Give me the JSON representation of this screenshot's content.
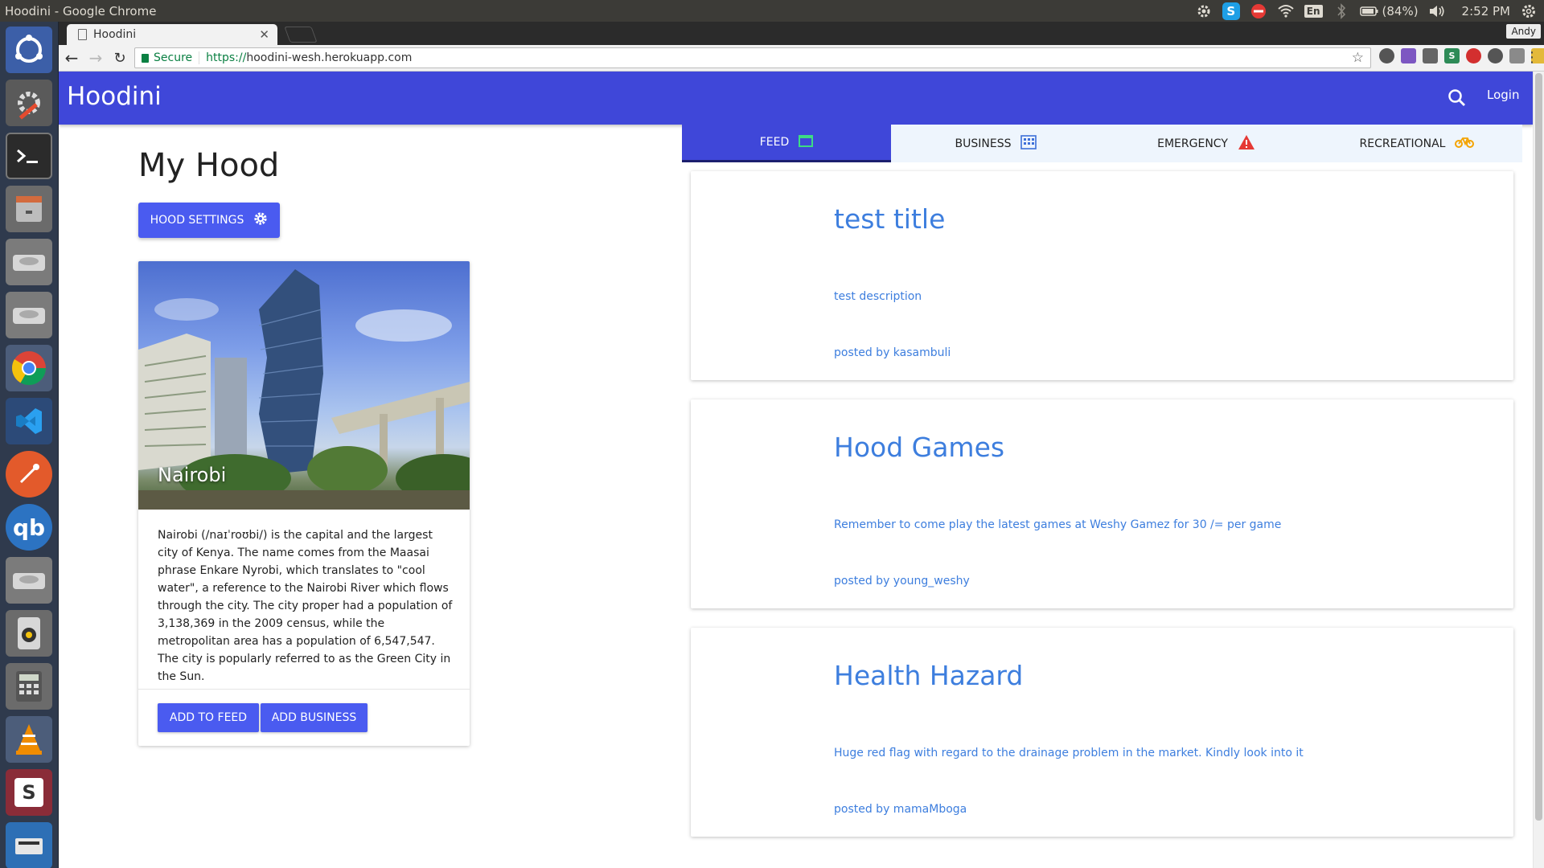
{
  "os": {
    "window_title": "Hoodini - Google Chrome",
    "battery": "(84%)",
    "clock": "2:52 PM",
    "language": "En"
  },
  "chrome": {
    "tab_title": "Hoodini",
    "profile": "Andy",
    "secure_label": "Secure",
    "url_scheme": "https://",
    "url_host": "hoodini-wesh.herokuapp.com"
  },
  "app": {
    "brand": "Hoodini",
    "login_label": "Login"
  },
  "hood": {
    "page_title": "My Hood",
    "settings_label": "HOOD SETTINGS",
    "city": "Nairobi",
    "description": "Nairobi (/naɪˈroʊbi/) is the capital and the largest city of Kenya. The name comes from the Maasai phrase Enkare Nyrobi, which translates to \"cool water\", a reference to the Nairobi River which flows through the city. The city proper had a population of 3,138,369 in the 2009 census, while the metropolitan area has a population of 6,547,547. The city is popularly referred to as the Green City in the Sun.",
    "add_feed_label": "ADD TO FEED",
    "add_business_label": "ADD BUSINESS"
  },
  "tabs": [
    {
      "label": "FEED",
      "icon": "calendar-icon",
      "active": true
    },
    {
      "label": "BUSINESS",
      "icon": "building-icon",
      "active": false
    },
    {
      "label": "EMERGENCY",
      "icon": "warning-icon",
      "active": false
    },
    {
      "label": "RECREATIONAL",
      "icon": "bike-icon",
      "active": false
    }
  ],
  "posts": [
    {
      "title": "test title",
      "description": "test description",
      "author": "posted by kasambuli"
    },
    {
      "title": "Hood Games",
      "description": "Remember to come play the latest games at Weshy Gamez for 30 /= per game",
      "author": "posted by young_weshy"
    },
    {
      "title": "Health Hazard",
      "description": "Huge red flag with regard to the drainage problem in the market. Kindly look into it",
      "author": "posted by mamaMboga"
    }
  ],
  "colors": {
    "app_bar": "#3f47d9",
    "button": "#4a5bf0",
    "link": "#3d7ede",
    "emergency": "#e53935",
    "recreational": "#f4a300",
    "feed_icon": "#3ddc84"
  }
}
